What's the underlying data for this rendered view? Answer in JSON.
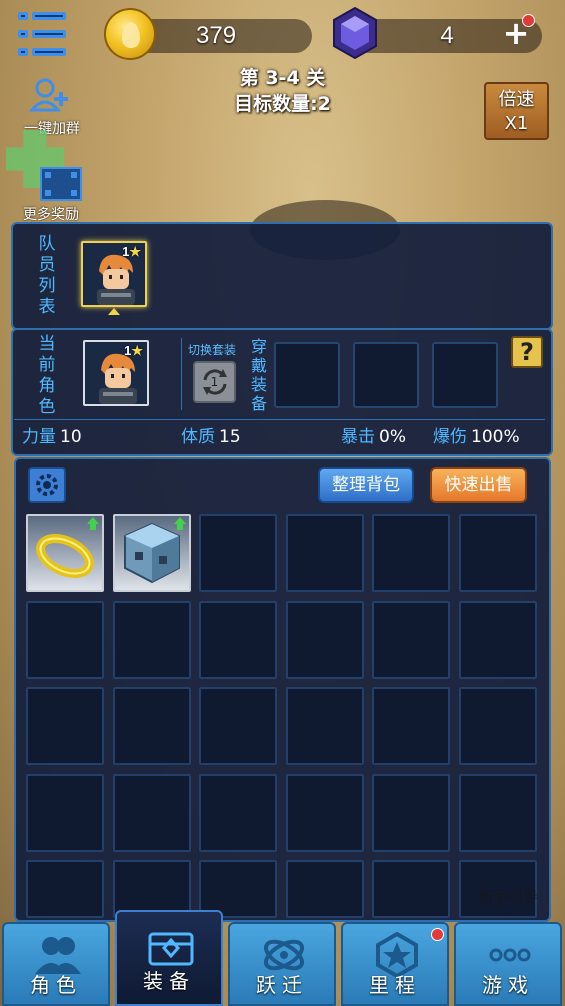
{
  "resources": {
    "coins": "379",
    "gems": "4"
  },
  "stage": {
    "title": "第 3-4 关",
    "target": "目标数量:2"
  },
  "speed": {
    "label": "倍速",
    "value": "X1"
  },
  "side": {
    "join_group": "一键加群",
    "more_rewards": "更多奖励"
  },
  "team": {
    "label_chars": [
      "队",
      "员",
      "列",
      "表"
    ],
    "hero_level": "1"
  },
  "current": {
    "label_chars": [
      "当",
      "前",
      "角",
      "色"
    ],
    "hero_level": "1",
    "switch_label": "切换套装",
    "switch_count": "1",
    "wear_chars": [
      "穿",
      "戴",
      "装",
      "备"
    ],
    "help": "?"
  },
  "stats": [
    {
      "key": "力量",
      "value": "10"
    },
    {
      "key": "体质",
      "value": "15"
    },
    {
      "key": "暴击",
      "value": "0%"
    },
    {
      "key": "爆伤",
      "value": "100%"
    }
  ],
  "bag": {
    "sort_label": "整理背包",
    "sell_label": "快速出售"
  },
  "items": [
    {
      "name": "gold-ring",
      "upgradable": true
    },
    {
      "name": "ice-cube-armor",
      "upgradable": true
    }
  ],
  "faint": {
    "hint": "新手引导"
  },
  "nav": {
    "tabs": [
      {
        "label": "角色",
        "icon": "users-icon"
      },
      {
        "label": "装备",
        "icon": "chest-icon"
      },
      {
        "label": "跃迁",
        "icon": "warp-icon"
      },
      {
        "label": "里程",
        "icon": "star-badge-icon"
      },
      {
        "label": "游戏",
        "icon": "more-icon"
      }
    ]
  },
  "colors": {
    "accent": "#4fb8ff",
    "panel": "#121e3c",
    "gold": "#f3c324",
    "danger": "#e23a3a"
  }
}
